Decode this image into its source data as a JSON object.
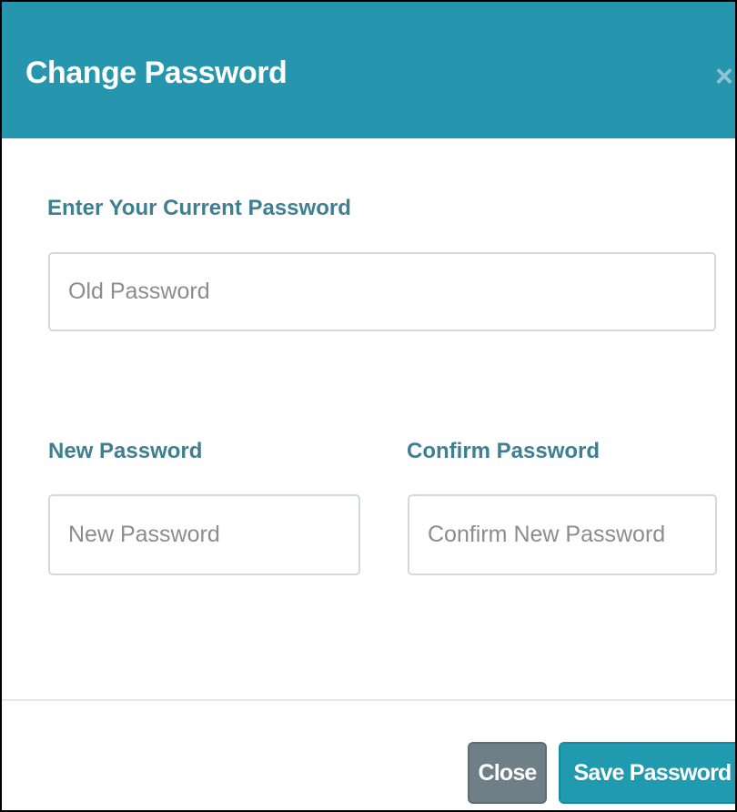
{
  "modal": {
    "title": "Change Password",
    "close_icon": "close-icon",
    "close_glyph": "×"
  },
  "form": {
    "current_password": {
      "label": "Enter Your Current Password",
      "value": "",
      "placeholder": "Old Password"
    },
    "new_password": {
      "label": "New Password",
      "value": "",
      "placeholder": "New Password"
    },
    "confirm_password": {
      "label": "Confirm Password",
      "value": "",
      "placeholder": "Confirm New Password"
    }
  },
  "footer": {
    "close_label": "Close",
    "save_label": "Save Password"
  },
  "colors": {
    "header_background": "#2596ad",
    "label_text": "#3f7f92",
    "close_button": "#6f7f88",
    "save_button": "#209aaf"
  }
}
